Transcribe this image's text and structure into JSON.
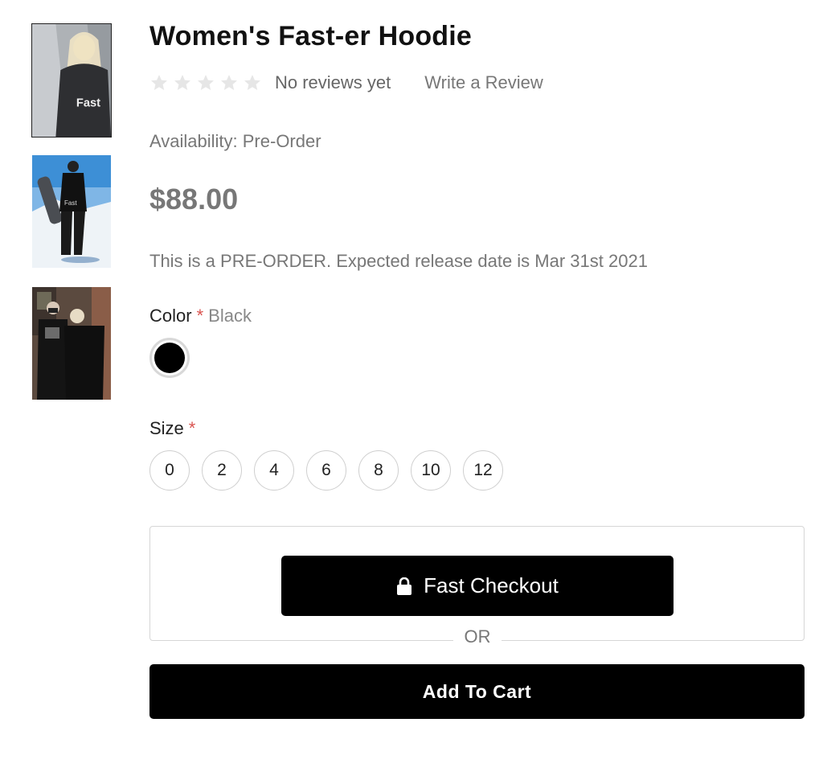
{
  "gallery": {
    "thumbnails": [
      {
        "alt": "hoodie-front-photo",
        "active": true
      },
      {
        "alt": "snowboarder-photo",
        "active": false
      },
      {
        "alt": "couple-photo",
        "active": false
      }
    ]
  },
  "product": {
    "title": "Women's Fast-er Hoodie",
    "rating": 0,
    "rating_max": 5,
    "reviews_text": "No reviews yet",
    "write_review": "Write a Review",
    "availability": "Availability: Pre-Order",
    "price": "$88.00",
    "preorder_note": "This is a PRE-ORDER. Expected release date is Mar 31st 2021"
  },
  "options": {
    "color": {
      "label": "Color",
      "required_mark": "*",
      "selected": "Black",
      "swatches": [
        {
          "name": "Black",
          "hex": "#000000"
        }
      ]
    },
    "size": {
      "label": "Size",
      "required_mark": "*",
      "values": [
        "0",
        "2",
        "4",
        "6",
        "8",
        "10",
        "12"
      ]
    }
  },
  "actions": {
    "fast_checkout": "Fast Checkout",
    "or": "OR",
    "add_to_cart": "Add To Cart"
  },
  "colors": {
    "button_bg": "#000000",
    "required": "#d9534f",
    "muted_text": "#777777",
    "star": "#e6e6e6"
  }
}
